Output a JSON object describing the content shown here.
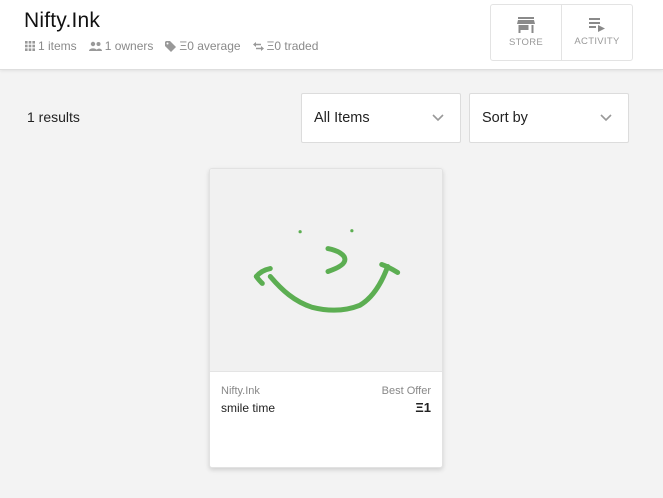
{
  "app": {
    "title": "Nifty.Ink"
  },
  "stats": [
    {
      "icon": "grid-icon",
      "text": "1 items"
    },
    {
      "icon": "people-icon",
      "text": "1 owners"
    },
    {
      "icon": "tag-icon",
      "text": "Ξ0 average"
    },
    {
      "icon": "swap-icon",
      "text": "Ξ0 traded"
    }
  ],
  "nav": {
    "store": {
      "label": "STORE",
      "icon": "store-icon"
    },
    "activity": {
      "label": "ACTIVITY",
      "icon": "playlist-icon"
    }
  },
  "results": {
    "text": "1 results"
  },
  "filters": {
    "items": {
      "value": "All Items"
    },
    "sort": {
      "value": "Sort by"
    }
  },
  "cards": [
    {
      "collection": "Nifty.Ink",
      "name": "smile time",
      "offer_label": "Best Offer",
      "price": "Ξ1",
      "ink_color": "#5cae52"
    }
  ]
}
